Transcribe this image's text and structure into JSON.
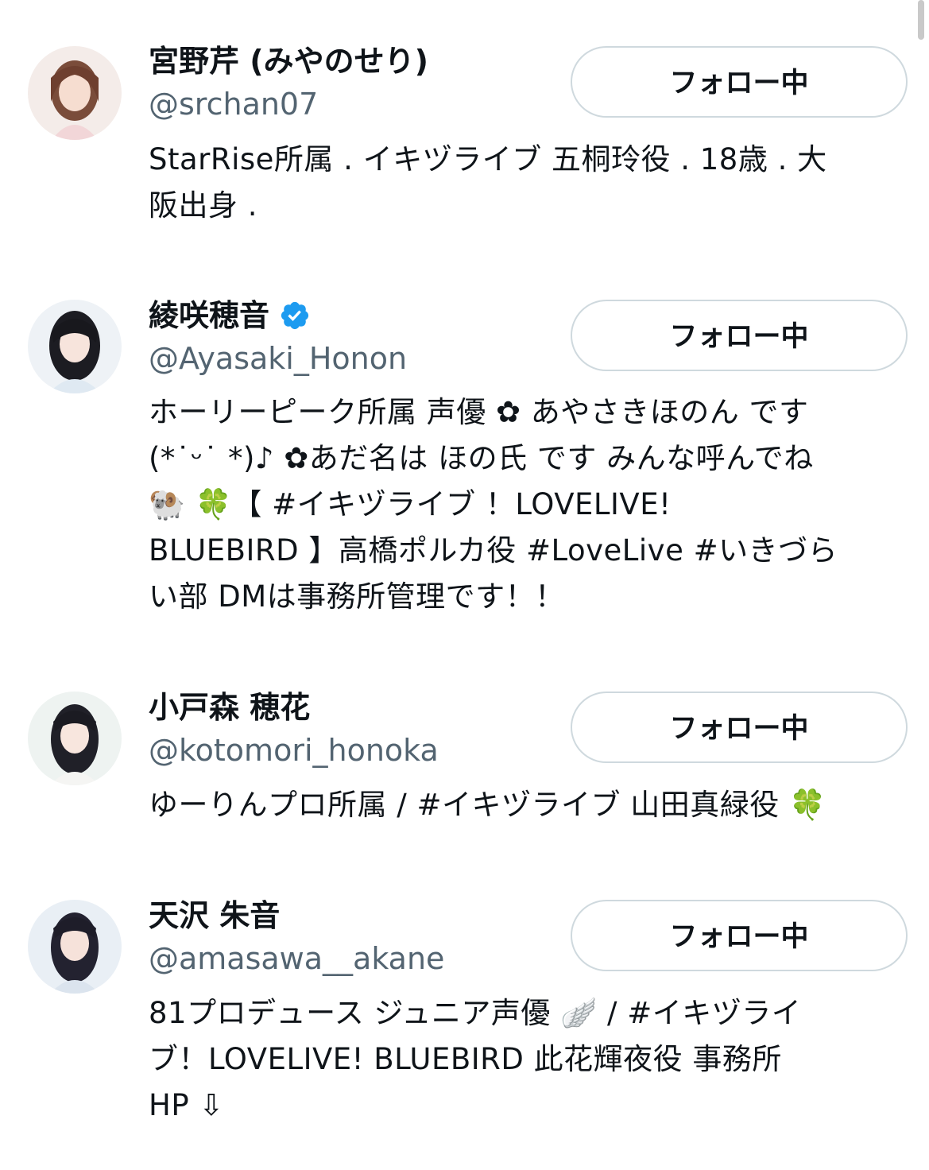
{
  "follow_label": "フォロー中",
  "colors": {
    "text_primary": "#0f1419",
    "text_secondary": "#536471",
    "button_border": "#cfd9de",
    "verified": "#1d9bf0"
  },
  "users": [
    {
      "display_name": "宮野芹 (みやのせり)",
      "handle": "@srchan07",
      "verified": false,
      "bio": "StarRise所属 . イキヅライブ 五桐玲役 . 18歳 . 大\n阪出身 ."
    },
    {
      "display_name": "綾咲穂音",
      "handle": "@Ayasaki_Honon",
      "verified": true,
      "bio": "ホーリーピーク所属 声優 ✿ あやさきほのん です\n(*˙ᵕ˙ *)♪ ✿あだ名は ほの氏 です みんな呼んでね\n🐏 🍀【 #イキヅライブ ！LOVELIVE!\nBLUEBIRD 】高橋ポルカ役 #LoveLive #いきづら\nい部 DMは事務所管理です！！"
    },
    {
      "display_name": "小戸森 穂花",
      "handle": "@kotomori_honoka",
      "verified": false,
      "bio": "ゆーりんプロ所属 / #イキヅライブ 山田真緑役 🍀"
    },
    {
      "display_name": "天沢 朱音",
      "handle": "@amasawa__akane",
      "verified": false,
      "bio": "81プロデュース ジュニア声優 🪽 / #イキヅライ\nブ！LOVELIVE! BLUEBIRD 此花輝夜役 事務所\nHP ⇩"
    }
  ]
}
